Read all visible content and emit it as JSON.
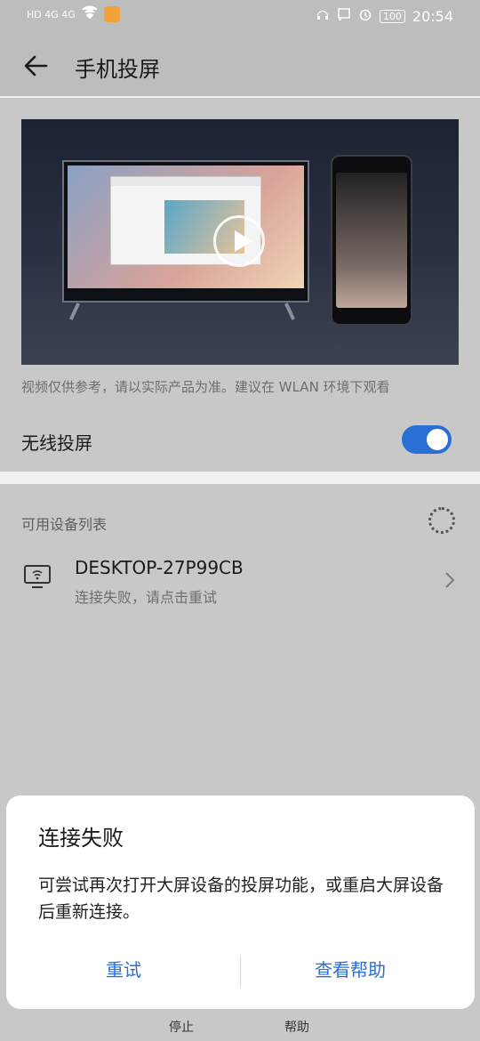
{
  "status_bar": {
    "network_left": "HD 4G 4G",
    "time": "20:54",
    "battery": "100"
  },
  "header": {
    "title": "手机投屏"
  },
  "intro": {
    "note": "视频仅供参考，请以实际产品为准。建议在 WLAN 环境下观看"
  },
  "wireless": {
    "label": "无线投屏",
    "enabled": true,
    "toggle_color": "#2a6fd6"
  },
  "device_list": {
    "header": "可用设备列表",
    "devices": [
      {
        "name": "DESKTOP-27P99CB",
        "status": "连接失败，请点击重试"
      }
    ]
  },
  "bottom_bar": {
    "stop_label": "停止",
    "help_label": "帮助"
  },
  "dialog": {
    "title": "连接失败",
    "body": "可尝试再次打开大屏设备的投屏功能，或重启大屏设备后重新连接。",
    "retry_label": "重试",
    "help_label": "查看帮助",
    "accent_color": "#2a6fd6"
  }
}
